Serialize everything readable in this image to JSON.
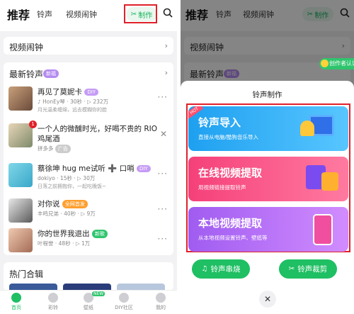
{
  "header": {
    "tab_recommend": "推荐",
    "tab_ringtone": "铃声",
    "tab_video_ringtone": "视频闹钟",
    "make_label": "制作"
  },
  "sections": {
    "video_alarm": "视频闹钟",
    "latest": "最新铃声",
    "latest_badge": "新福",
    "hot": "热门合辑"
  },
  "songs": [
    {
      "name": "再见了莫妮卡",
      "badge": "DIY",
      "meta": "♪ HonEy琴 · 30秒 · ▷ 232万",
      "desc": "月光温柔缠绵，远去模糊你的脸"
    },
    {
      "name": "一个人的微醺时光，好喝不贵的 RIO",
      "name2": "鸡尾酒",
      "meta": "拼多多",
      "badge2": "广告"
    },
    {
      "name": "蔡徐坤 hug me试听 ➕ 口哨",
      "badge": "DIY",
      "meta": "dokiyo · 15秒 · ▷ 30万",
      "desc": "日落之前拥抱你，一起吃晚饭~"
    },
    {
      "name": "对你说",
      "badge": "全网首发",
      "meta": "丰鸣兄弟 · 40秒 · ▷ 9万"
    },
    {
      "name": "你的世界我退出",
      "badge": "新歌",
      "meta": "叶程誉 · 48秒 · ▷ 1万"
    }
  ],
  "nav": [
    "首页",
    "彩铃",
    "壁纸",
    "DIY社区",
    "我的"
  ],
  "nav_new_badge": "NEW",
  "notify_badge": "1",
  "creator_badge": "创作者认证",
  "sheet": {
    "title": "铃声制作",
    "hot_tag": "HOT",
    "banners": [
      {
        "title": "铃声导入",
        "sub": "直接从电脑/酷狗音乐导入"
      },
      {
        "title": "在线视频提取",
        "sub": "用视频链接提取铃声"
      },
      {
        "title": "本地视频提取",
        "sub": "从本地视频设置铃声、壁纸等"
      }
    ],
    "btn_left": "铃声串烧",
    "btn_right": "铃声裁剪",
    "close": "✕"
  },
  "colors": {
    "accent": "#1fbf63",
    "highlight_box": "#e0212a",
    "banner1": "#1ea0f0",
    "banner2": "#f5407a",
    "banner3": "#a05cf0"
  }
}
